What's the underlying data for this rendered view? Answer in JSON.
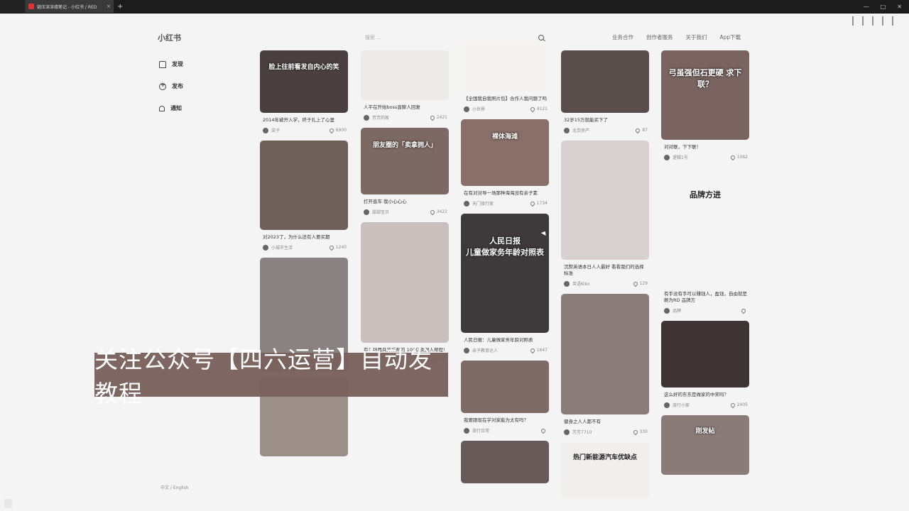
{
  "browser": {
    "tab_title": "链压深深缘笔记 - 小红书 / RED",
    "close_glyph": "×",
    "new_tab_glyph": "+",
    "window_controls": [
      "—",
      "□",
      "✕"
    ]
  },
  "header": {
    "logo": "小红书",
    "search_placeholder": "搜索 ...",
    "nav": [
      "业务合作",
      "创作者服务",
      "关于我们",
      "App下载"
    ]
  },
  "sidebar": {
    "items": [
      {
        "label": "发现",
        "icon": "home-icon"
      },
      {
        "label": "发布",
        "icon": "publish-icon"
      },
      {
        "label": "通知",
        "icon": "bell-icon"
      }
    ],
    "footer": "中文 / English"
  },
  "overlay": {
    "banner_text": "关注公众号【四六运营】自动发教程"
  },
  "colors": {
    "page_bg": "#f4f4f4",
    "banner_bg": "#7a625e",
    "accent": "#e03434"
  },
  "feed": {
    "col1": [
      {
        "cover_text": "脸上往前看发自内心的笑",
        "bg": "#4a4040",
        "h": 88,
        "title": "2014年被开入学，终于扎上了心里",
        "author": "梁子",
        "likes": "6900"
      },
      {
        "cover_text": "",
        "bg": "#6e6058",
        "h": 126,
        "title": "对2023了，为什么还有人要买期",
        "author": "小城市生活",
        "likes": "1240"
      },
      {
        "cover_text": "",
        "bg": "#8a8280",
        "h": 160,
        "title": "",
        "author": "",
        "likes": ""
      },
      {
        "cover_text": "",
        "bg": "#9c8e88",
        "h": 110,
        "title": "",
        "author": "",
        "likes": ""
      }
    ],
    "col2": [
      {
        "cover_text": "",
        "bg": "#efeaea",
        "h": 70,
        "title": "人平在开始boss直聊人回复",
        "author": "芳芳的家",
        "likes": "2421"
      },
      {
        "cover_text": "朋友圈的「卖拿拥人」",
        "bg": "#7d6964",
        "h": 94,
        "title": "打开直车 我小心心心",
        "author": "甜甜宝贝",
        "likes": "3422"
      },
      {
        "cover_text": "",
        "bg": "#c9c0be",
        "h": 170,
        "title": "有关钱西兵开采帮的 100亿卖据人帮程!",
        "author": "某某某",
        "likes": "1792"
      },
      {
        "cover_text": "",
        "bg": "#f4f4f4",
        "h": 100,
        "title": "",
        "author": "",
        "likes": ""
      }
    ],
    "col3": [
      {
        "cover_text": "",
        "bg": "#f6f2f2",
        "h": 70,
        "title": "【全国我自我照片包】合作人我问题了吗",
        "author": "小世界",
        "likes": "4121"
      },
      {
        "cover_text": "裸体海滩",
        "bg": "#8a6e6a",
        "h": 94,
        "title": "在有对对导一场那种海海没有亲子素",
        "author": "天门旅行家",
        "likes": "1734"
      },
      {
        "cover_text": "人民日报\n儿童做家务年龄对照表",
        "bg": "#3e3a3c",
        "h": 168,
        "title": "人民日报：儿童做家务年龄对照表",
        "author": "亲子教育达人",
        "likes": "1647"
      },
      {
        "cover_text": "",
        "bg": "#7d6b66",
        "h": 74,
        "title": "我要跟现在学对家能为太有吗？",
        "author": "旅行日常",
        "likes": ""
      },
      {
        "cover_text": "",
        "bg": "#685a58",
        "h": 60,
        "title": "",
        "author": "",
        "likes": ""
      }
    ],
    "col4": [
      {
        "cover_text": "",
        "bg": "#5a4e4c",
        "h": 88,
        "title": "32岁15万就能买下了",
        "author": "北京房产",
        "likes": "87"
      },
      {
        "cover_text": "",
        "bg": "#d8d0ce",
        "h": 168,
        "title": "沉默英语本日人人最好 看看我们的选择标准",
        "author": "英语Kiko",
        "likes": "129"
      },
      {
        "cover_text": "",
        "bg": "#8a7c78",
        "h": 170,
        "title": "健身之人人都不有",
        "author": "芳芳7710",
        "likes": "330"
      },
      {
        "cover_text": "热门新能源汽车优缺点",
        "bg": "#f2eeee",
        "h": 80,
        "title": "",
        "author": "",
        "likes": ""
      }
    ],
    "col5": [
      {
        "cover_text": "弓虽强但石更硬 求下联？",
        "bg": "#7a6460",
        "h": 126,
        "title": "对对联，下下联！",
        "author": "逻辑1号",
        "likes": "1062"
      },
      {
        "cover_text": "品牌方进",
        "bg": "#f4f4f4",
        "h": 168,
        "title": "有手没有手可以赚钱人，盈钱，自由就是刷为RD 品牌方",
        "author": "品牌",
        "likes": ""
      },
      {
        "cover_text": "",
        "bg": "#3e3434",
        "h": 94,
        "title": "这么好的东东是做家的中奖吗？",
        "author": "旅行小家",
        "likes": "2405"
      },
      {
        "cover_text": "刚发帖",
        "bg": "#8a7a78",
        "h": 84,
        "title": "",
        "author": "",
        "likes": ""
      }
    ]
  }
}
